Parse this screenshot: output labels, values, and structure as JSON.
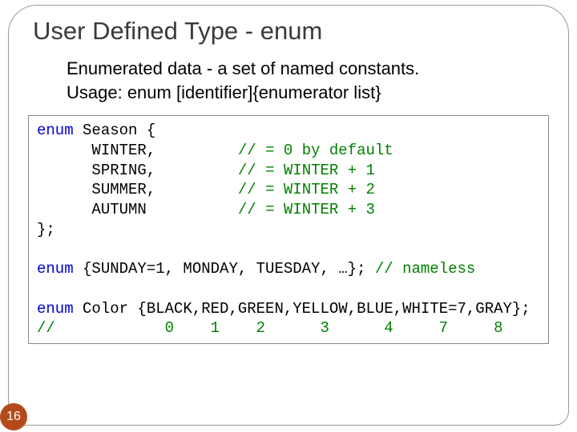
{
  "title": "User Defined Type - enum",
  "body_line1": "Enumerated data - a set of named constants.",
  "body_line2": "Usage: enum [identifier]{enumerator list}",
  "code": {
    "kw_enum": "enum",
    "season": "Season {",
    "members": [
      {
        "name": "WINTER,",
        "comment": "// = 0 by default"
      },
      {
        "name": "SPRING,",
        "comment": "// = WINTER + 1"
      },
      {
        "name": "SUMMER,",
        "comment": "// = WINTER + 2"
      },
      {
        "name": "AUTUMN",
        "comment": "// = WINTER + 3"
      }
    ],
    "close": "};",
    "nameless_body": "{SUNDAY=1, MONDAY, TUESDAY, …};",
    "nameless_comment": "// nameless",
    "color_decl": "Color {BLACK,RED,GREEN,YELLOW,BLUE,WHITE=7,GRAY};",
    "index_line": "//            0    1    2      3      4     7     8"
  },
  "page_number": "16"
}
